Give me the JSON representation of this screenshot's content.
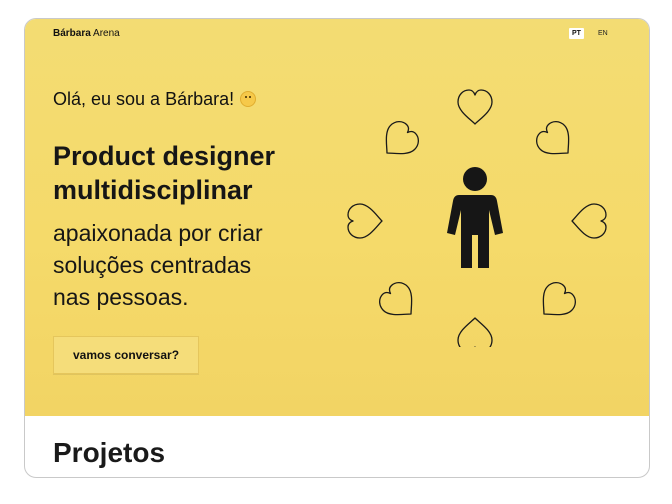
{
  "header": {
    "brand_first": "Bárbara",
    "brand_last": "Arena",
    "lang_pt": "PT",
    "lang_en": "EN"
  },
  "hero": {
    "greeting": "Olá, eu sou a Bárbara!",
    "headline_line1": "Product designer",
    "headline_line2": "multidisciplinar",
    "subline_line1": "apaixonada por criar",
    "subline_line2": "soluções centradas",
    "subline_line3": "nas pessoas.",
    "cta_label": "vamos conversar?",
    "illustration": "person-surrounded-by-hearts",
    "colors": {
      "accent": "#f5da6a",
      "ink": "#161616"
    }
  },
  "projects": {
    "heading": "Projetos"
  }
}
